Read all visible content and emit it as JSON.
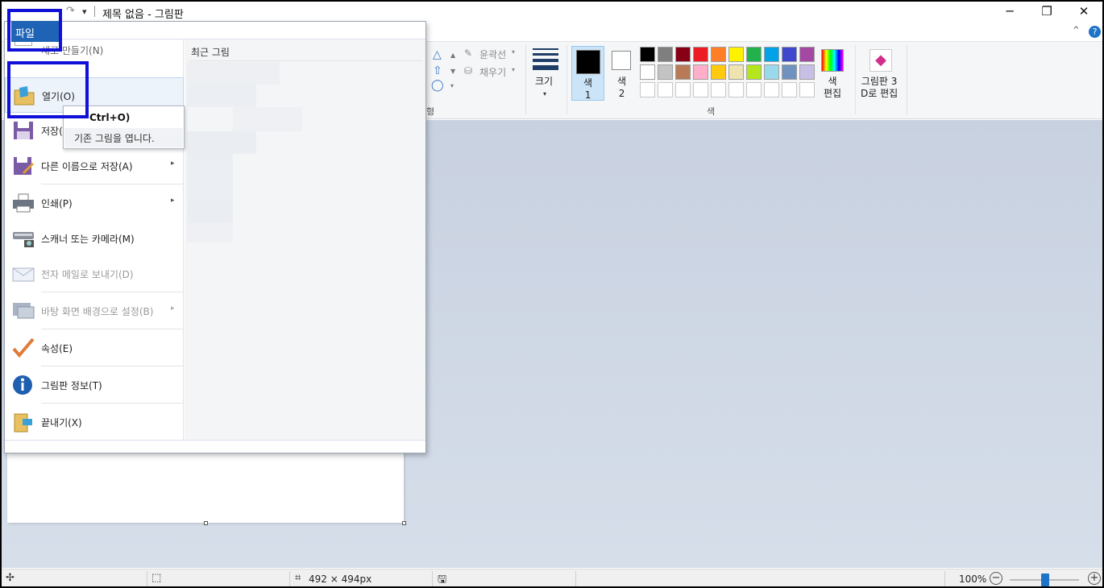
{
  "window": {
    "title": "제목 없음 - 그림판",
    "minimize_glyph": "─",
    "restore_glyph": "❐",
    "close_glyph": "✕",
    "collapse_glyph": "⌃",
    "help_glyph": "?"
  },
  "quick_access": {
    "redo_glyph": "↷",
    "customize_glyph": "▾"
  },
  "file_menu": {
    "tab_label": "파일",
    "recent_title": "최근 그림",
    "items": [
      {
        "label": "새로 만들기(N)",
        "icon": "new-document-icon"
      },
      {
        "label": "열기(O)",
        "icon": "open-folder-icon"
      },
      {
        "label": "저장(",
        "icon": "save-disk-icon"
      },
      {
        "label": "다른 이름으로 저장(A)",
        "icon": "save-as-icon",
        "arrow": "▸"
      },
      {
        "label": "인쇄(P)",
        "icon": "printer-icon",
        "arrow": "▸"
      },
      {
        "label": "스캐너 또는 카메라(M)",
        "icon": "scanner-icon"
      },
      {
        "label": "전자 메일로 보내기(D)",
        "icon": "email-icon"
      },
      {
        "label": "바탕 화면 배경으로 설정(B)",
        "icon": "desktop-background-icon",
        "arrow": "▸"
      },
      {
        "label": "속성(E)",
        "icon": "checkmark-icon"
      },
      {
        "label": "그림판 정보(T)",
        "icon": "info-icon"
      },
      {
        "label": "끝내기(X)",
        "icon": "exit-icon"
      }
    ],
    "tooltip": {
      "shortcut": "Ctrl+O)",
      "description": "기존 그림을 엽니다."
    }
  },
  "ribbon": {
    "outline_label": "윤곽선",
    "fill_label": "채우기",
    "shapes_group_label": "형",
    "size_label": "크기",
    "color1_label": "색\n1",
    "color2_label": "색\n2",
    "colors_group_label": "색",
    "edit_colors_label": "색\n편집",
    "paint3d_label": "그림판 3\nD로 편집",
    "palette": [
      "#000000",
      "#7f7f7f",
      "#880015",
      "#ed1c24",
      "#ff7f27",
      "#fff200",
      "#22b14c",
      "#00a2e8",
      "#3f48cc",
      "#a349a4",
      "#ffffff",
      "#c3c3c3",
      "#b97a57",
      "#ffaec9",
      "#ffc90e",
      "#efe4b0",
      "#b5e61d",
      "#99d9ea",
      "#7092be",
      "#c8bfe7",
      "#ffffff",
      "#ffffff",
      "#ffffff",
      "#ffffff",
      "#ffffff",
      "#ffffff",
      "#ffffff",
      "#ffffff",
      "#ffffff",
      "#ffffff"
    ],
    "color1": "#000000",
    "color2": "#ffffff"
  },
  "statusbar": {
    "move_glyph": "✢",
    "selection_glyph": "⬚",
    "size_glyph": "⌗",
    "image_size": "492 × 494px",
    "save_glyph": "🖫",
    "zoom": "100%",
    "zoom_out": "−",
    "zoom_in": "+"
  }
}
